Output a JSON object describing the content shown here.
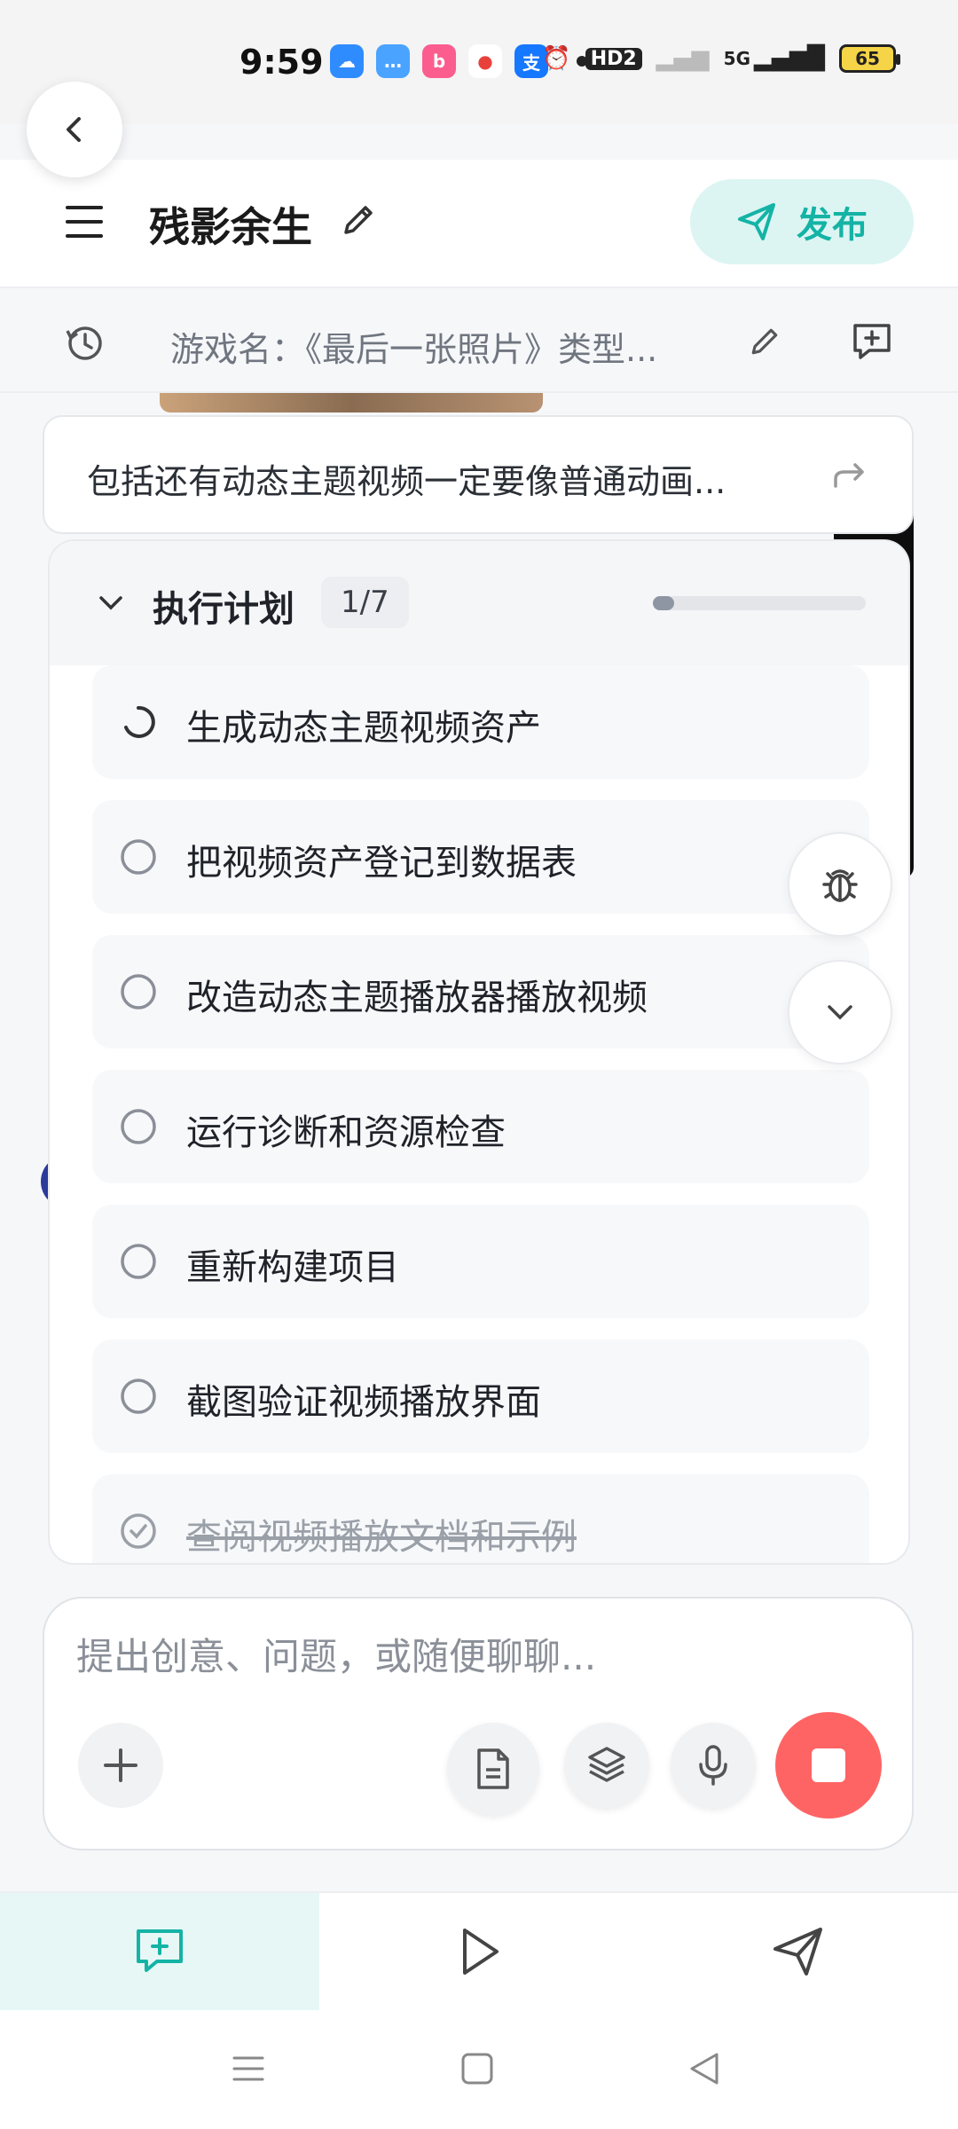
{
  "status_bar": {
    "time": "9:59",
    "apps": [
      {
        "icon": "cloud-app-icon",
        "color": "#2f8cff",
        "glyph": "☁"
      },
      {
        "icon": "chat-bubble-app-icon",
        "color": "#4aa3ff",
        "glyph": "…"
      },
      {
        "icon": "bilibili-app-icon",
        "color": "#fb5d8f",
        "glyph": "b"
      },
      {
        "icon": "map-pin-app-icon",
        "color": "#e8413b",
        "glyph": "●"
      },
      {
        "icon": "alipay-app-icon",
        "color": "#1677ff",
        "glyph": "支"
      }
    ],
    "hd_label": "HD2",
    "network_label": "5G",
    "battery_level": "65"
  },
  "header": {
    "project_title": "残影余生",
    "publish_label": "发布"
  },
  "info_bar": {
    "game_name": "游戏名：《最后一张照片》类型..."
  },
  "prompt_card": {
    "text": "包括还有动态主题视频一定要像普通动画..."
  },
  "plan": {
    "title": "执行计划",
    "count": "1/7",
    "progress": 0.1,
    "items": [
      {
        "label": "生成动态主题视频资产",
        "status": "running"
      },
      {
        "label": "把视频资产登记到数据表",
        "status": "pending"
      },
      {
        "label": "改造动态主题播放器播放视频",
        "status": "pending"
      },
      {
        "label": "运行诊断和资源检查",
        "status": "pending"
      },
      {
        "label": "重新构建项目",
        "status": "pending"
      },
      {
        "label": "截图验证视频播放界面",
        "status": "pending"
      },
      {
        "label": "查阅视频播放文档和示例",
        "status": "done"
      }
    ]
  },
  "composer": {
    "placeholder": "提出创意、问题，或随便聊聊..."
  },
  "tabs": [
    {
      "icon": "chat-plus-icon",
      "active": true
    },
    {
      "icon": "play-icon",
      "active": false
    },
    {
      "icon": "send-icon",
      "active": false
    }
  ],
  "colors": {
    "accent": "#14b3a5",
    "stop": "#ff6464"
  }
}
